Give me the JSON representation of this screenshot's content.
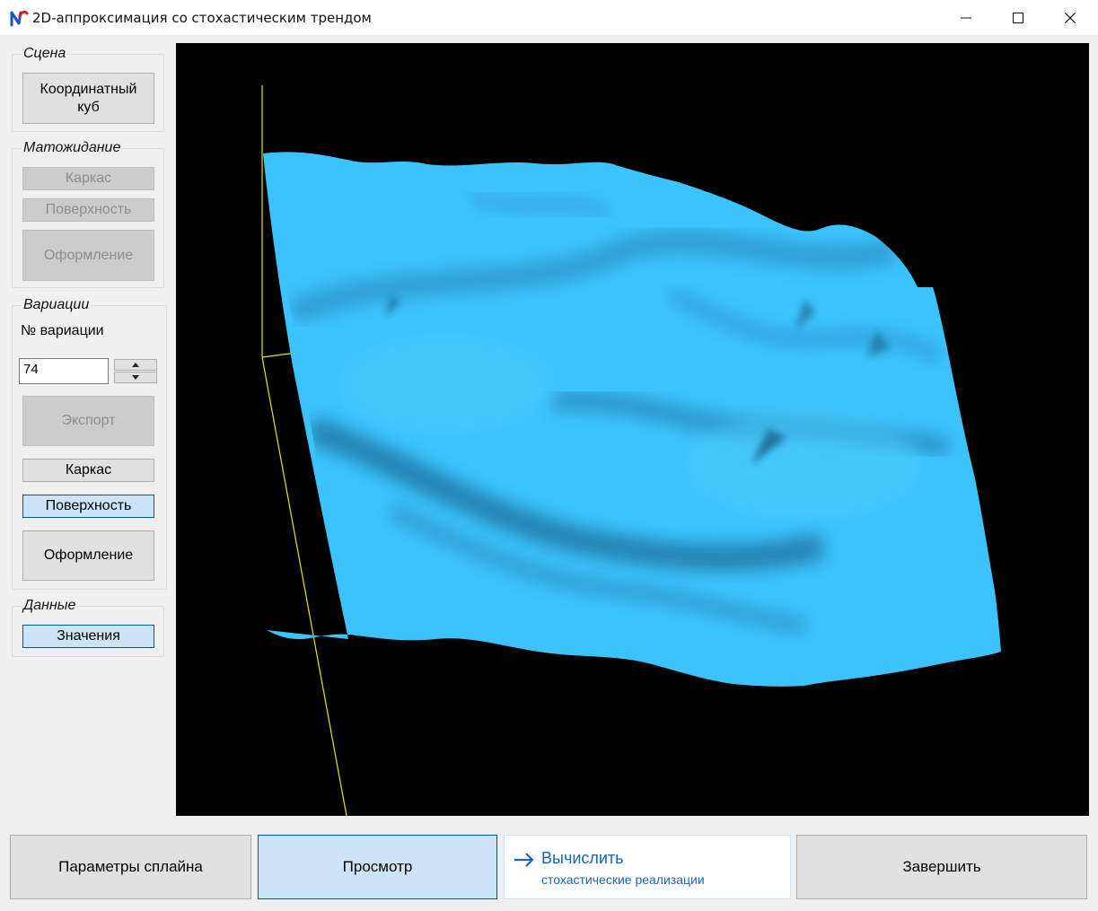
{
  "window": {
    "title": "2D-аппроксимация со стохастическим трендом"
  },
  "panels": {
    "scene": {
      "legend": "Сцена",
      "coord_cube_line1": "Координатный",
      "coord_cube_line2": "куб"
    },
    "expectation": {
      "legend": "Матожидание",
      "wireframe": "Каркас",
      "surface": "Поверхность",
      "styling": "Оформление"
    },
    "variations": {
      "legend": "Вариации",
      "number_label": "№ вариации",
      "number_value": "74",
      "export": "Экспорт",
      "wireframe": "Каркас",
      "surface": "Поверхность",
      "styling": "Оформление"
    },
    "data": {
      "legend": "Данные",
      "values": "Значения"
    }
  },
  "bottom": {
    "spline_params": "Параметры сплайна",
    "view": "Просмотр",
    "compute_main": "Вычислить",
    "compute_sub": "стохастические реализации",
    "finish": "Завершить"
  },
  "colors": {
    "accent": "#1e63b5",
    "surface": "#3cc3fb",
    "axes": "#e6e600",
    "viewport_bg": "#000000"
  }
}
